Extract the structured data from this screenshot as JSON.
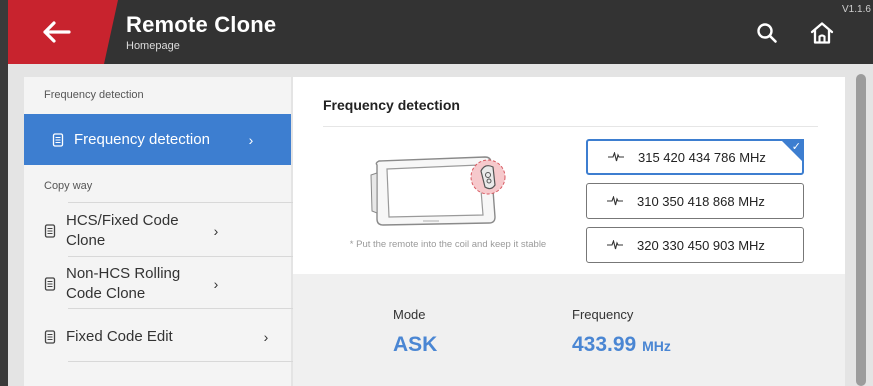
{
  "header": {
    "title": "Remote Clone",
    "subtitle": "Homepage",
    "version": "V1.1.6",
    "accent_color": "#c8232e",
    "icons": {
      "back": "arrow-left-icon",
      "search": "search-icon",
      "home": "home-icon"
    }
  },
  "sidebar": {
    "section_frequency": "Frequency detection",
    "section_copy": "Copy way",
    "items": [
      {
        "label": "Frequency detection",
        "active": true
      },
      {
        "label": "HCS/Fixed Code Clone",
        "active": false
      },
      {
        "label": "Non-HCS Rolling Code Clone",
        "active": false
      },
      {
        "label": "Fixed Code Edit",
        "active": false
      }
    ],
    "item_icon": "remote-icon",
    "chevron": "›",
    "active_color": "#3d7ed0"
  },
  "main": {
    "title": "Frequency detection",
    "hint": "* Put the remote into the coil and keep it stable",
    "frequency_options": [
      {
        "label": "315 420 434 786 MHz",
        "selected": true
      },
      {
        "label": "310 350 418 868 MHz",
        "selected": false
      },
      {
        "label": "320 330 450 903 MHz",
        "selected": false
      }
    ],
    "check": "✓",
    "result": {
      "mode_label": "Mode",
      "mode_value": "ASK",
      "frequency_label": "Frequency",
      "frequency_value": "433.99",
      "frequency_unit": "MHz",
      "value_color": "#4a86d3"
    }
  }
}
